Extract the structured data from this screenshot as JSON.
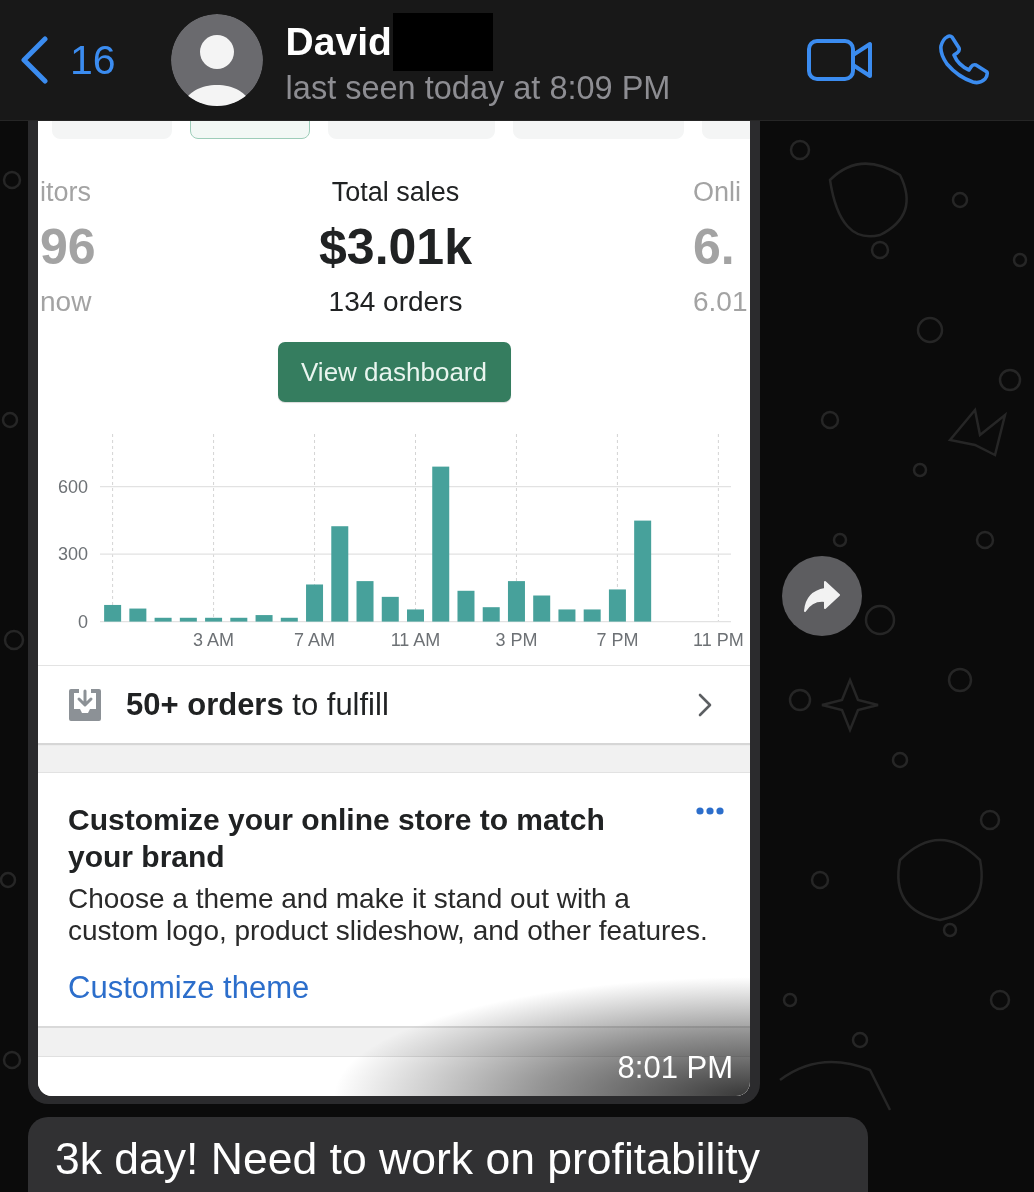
{
  "header": {
    "back_count": "16",
    "contact_name": "David",
    "status": "last seen today at 8:09 PM"
  },
  "messages": [
    {
      "kind": "screenshot",
      "time": "8:01 PM",
      "screenshot": {
        "tabs": [
          {
            "selected": false
          },
          {
            "selected": true
          },
          {
            "selected": false
          },
          {
            "selected": false
          },
          {
            "selected": false
          }
        ],
        "metrics": [
          {
            "label": "itors",
            "value": "96",
            "detail": "now",
            "selected": false
          },
          {
            "label": "Total sales",
            "value": "$3.01k",
            "detail": "134 orders",
            "selected": true
          },
          {
            "label": "Onli",
            "value": "6.",
            "detail": "6.01",
            "selected": false
          }
        ],
        "button": "View dashboard",
        "chart_data": {
          "type": "bar",
          "categories": [
            null,
            null,
            null,
            null,
            "3 AM",
            null,
            null,
            null,
            "7 AM",
            null,
            null,
            null,
            "11 AM",
            null,
            null,
            null,
            "3 PM",
            null,
            null,
            null,
            "7 PM",
            null,
            null,
            null,
            "11 PM"
          ],
          "series": [
            {
              "color": "#47a19b",
              "values": [
                74,
                58,
                17,
                17,
                17,
                17,
                29,
                17,
                165,
                424,
                180,
                110,
                54,
                689,
                137,
                64,
                180,
                116,
                54,
                54,
                143,
                449,
                null,
                null,
                null
              ]
            }
          ],
          "ylim": [
            0,
            834
          ],
          "yticks": [
            0,
            300,
            600
          ],
          "grid": true
        },
        "tasks": [
          {
            "text": "**50+ orders** to fulfill"
          }
        ],
        "card": {
          "title": "Customize your online store to match your brand",
          "body": "Choose a theme and make it stand out with a custom logo, product slideshow, and other features.",
          "link": "Customize theme"
        }
      }
    },
    {
      "kind": "text",
      "text": "3k day! Need to work on profitability"
    }
  ]
}
